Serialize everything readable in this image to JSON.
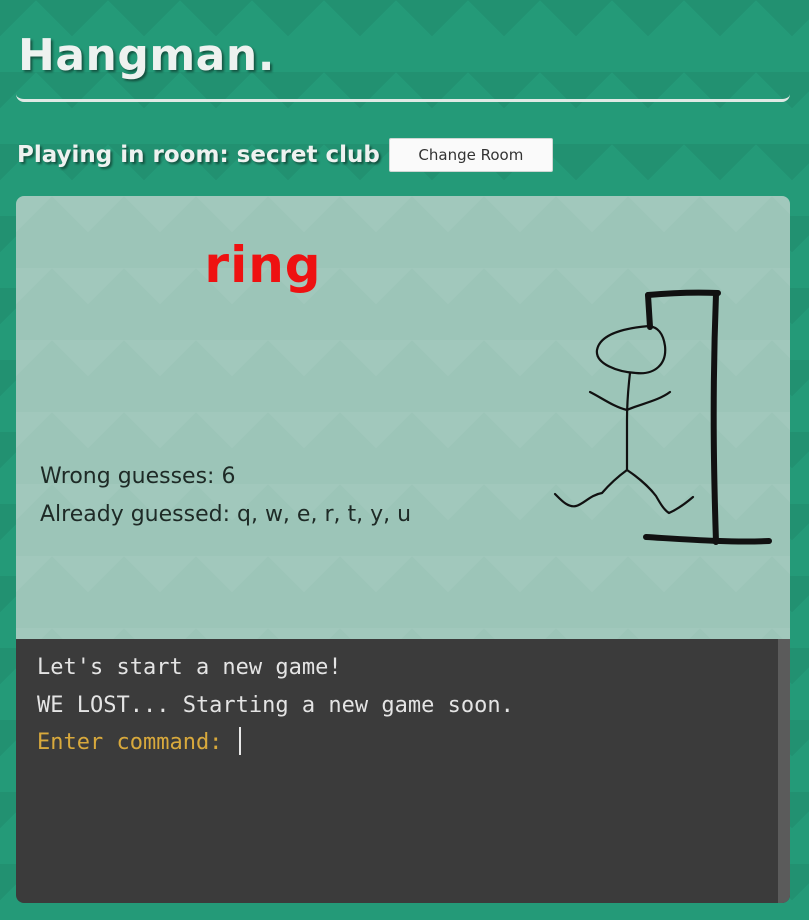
{
  "header": {
    "title": "Hangman."
  },
  "room": {
    "label": "Playing in room: secret club",
    "change_button": "Change Room"
  },
  "game": {
    "word": "ring",
    "wrong_guesses_text": "Wrong guesses: 6",
    "already_guessed_text": "Already guessed: q, w, e, r, t, y, u"
  },
  "terminal": {
    "lines": [
      "Let's start a new game!",
      "WE LOST... Starting a new game soon."
    ],
    "prompt": "Enter command: "
  },
  "colors": {
    "background": "#249a78",
    "panel": "#9cc5b8",
    "word": "#ee1111",
    "terminal": "#3b3b3b",
    "prompt": "#d8a93c"
  }
}
